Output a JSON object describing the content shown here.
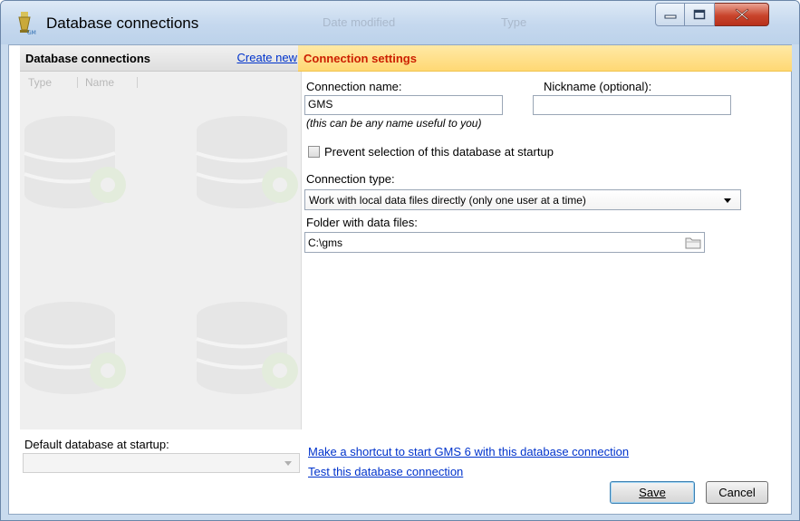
{
  "window": {
    "title": "Database connections",
    "ghost_header_1": "Date modified",
    "ghost_header_2": "Type"
  },
  "left_panel": {
    "title": "Database connections",
    "create_new": "Create new",
    "columns": [
      "Type",
      "Name"
    ],
    "default_label": "Default database at startup:",
    "default_value": ""
  },
  "right_panel": {
    "title": "Connection settings",
    "connection_name_label": "Connection name:",
    "connection_name_value": "GMS",
    "connection_name_hint": "(this can be any name useful to you)",
    "nickname_label": "Nickname (optional):",
    "nickname_value": "",
    "prevent_label": "Prevent selection of this database at startup",
    "prevent_checked": false,
    "connection_type_label": "Connection type:",
    "connection_type_value": "Work with local data files directly (only one user at a time)",
    "folder_label": "Folder with data files:",
    "folder_value": "C:\\gms",
    "shortcut_link": "Make a shortcut to start GMS 6 with this database connection",
    "test_link": "Test this database connection",
    "save_label": "Save",
    "cancel_label": "Cancel"
  },
  "icons": {
    "title": "database-app-icon",
    "minimize": "minimize-icon",
    "maximize": "maximize-icon",
    "close": "close-icon",
    "folder": "folder-icon"
  },
  "colors": {
    "accent_header": "#ffd874",
    "accent_title": "#cc1f00",
    "link": "#0033cc",
    "close_button": "#c9452c"
  }
}
